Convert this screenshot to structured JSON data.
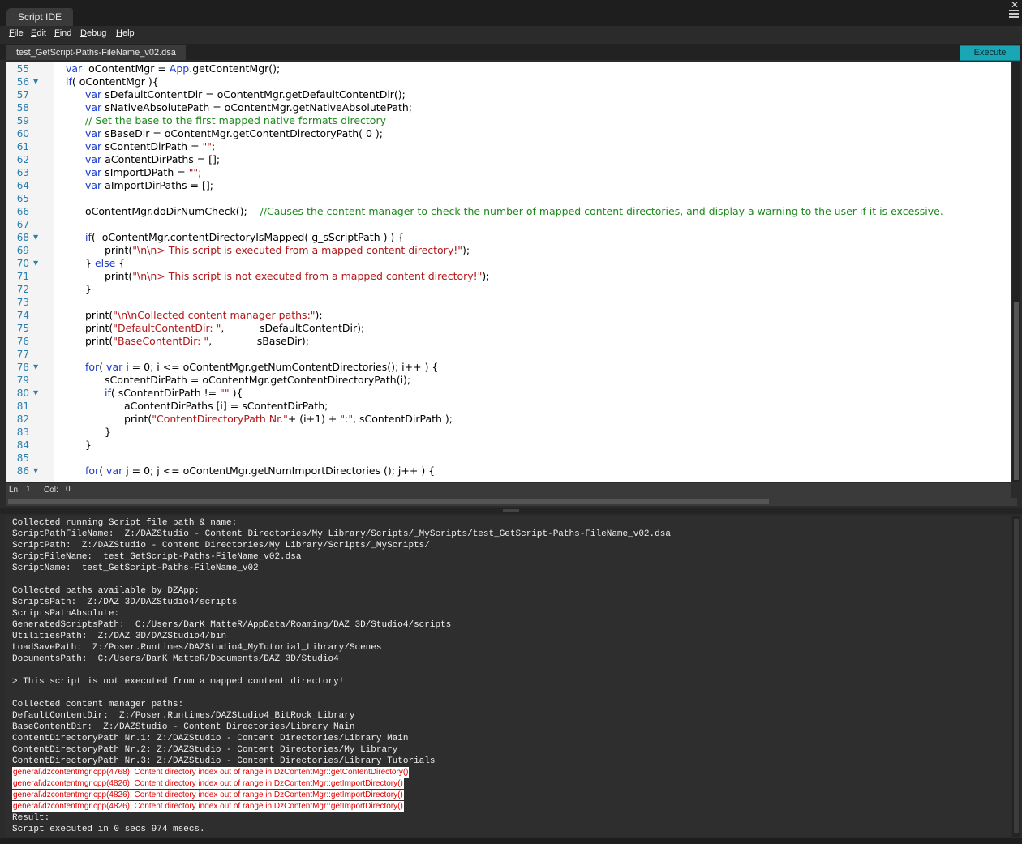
{
  "window": {
    "title": "Script IDE"
  },
  "menu": [
    {
      "accel": "F",
      "rest": "ile"
    },
    {
      "accel": "E",
      "rest": "dit"
    },
    {
      "accel": "F",
      "rest": "ind"
    },
    {
      "accel": "D",
      "rest": "ebug"
    },
    {
      "accel": "H",
      "rest": "elp"
    }
  ],
  "file_tab": "test_GetScript-Paths-FileName_v02.dsa",
  "execute_label": "Execute",
  "status": {
    "ln_label": "Ln:",
    "ln": "1",
    "col_label": "Col:",
    "col": "0"
  },
  "code_lines": [
    {
      "n": "55",
      "fold": false,
      "indent": 1,
      "parts": [
        [
          "kw",
          "var"
        ],
        [
          "",
          "  oContentMgr = "
        ],
        [
          "kw",
          "App"
        ],
        [
          "",
          ".getContentMgr();"
        ]
      ]
    },
    {
      "n": "56",
      "fold": true,
      "indent": 1,
      "parts": [
        [
          "kw",
          "if"
        ],
        [
          "",
          "( oContentMgr ){"
        ]
      ]
    },
    {
      "n": "57",
      "fold": false,
      "indent": 2,
      "parts": [
        [
          "kw",
          "var"
        ],
        [
          "",
          " sDefaultContentDir = oContentMgr.getDefaultContentDir();"
        ]
      ]
    },
    {
      "n": "58",
      "fold": false,
      "indent": 2,
      "parts": [
        [
          "kw",
          "var"
        ],
        [
          "",
          " sNativeAbsolutePath = oContentMgr.getNativeAbsolutePath;"
        ]
      ]
    },
    {
      "n": "59",
      "fold": false,
      "indent": 2,
      "parts": [
        [
          "cm",
          "// Set the base to the first mapped native formats directory"
        ]
      ]
    },
    {
      "n": "60",
      "fold": false,
      "indent": 2,
      "parts": [
        [
          "kw",
          "var"
        ],
        [
          "",
          " sBaseDir = oContentMgr.getContentDirectoryPath( 0 );"
        ]
      ]
    },
    {
      "n": "61",
      "fold": false,
      "indent": 2,
      "parts": [
        [
          "kw",
          "var"
        ],
        [
          "",
          " sContentDirPath = "
        ],
        [
          "st",
          "\"\""
        ],
        [
          "",
          ";"
        ]
      ]
    },
    {
      "n": "62",
      "fold": false,
      "indent": 2,
      "parts": [
        [
          "kw",
          "var"
        ],
        [
          "",
          " aContentDirPaths = [];"
        ]
      ]
    },
    {
      "n": "63",
      "fold": false,
      "indent": 2,
      "parts": [
        [
          "kw",
          "var"
        ],
        [
          "",
          " sImportDPath = "
        ],
        [
          "st",
          "\"\""
        ],
        [
          "",
          ";"
        ]
      ]
    },
    {
      "n": "64",
      "fold": false,
      "indent": 2,
      "parts": [
        [
          "kw",
          "var"
        ],
        [
          "",
          " aImportDirPaths = [];"
        ]
      ]
    },
    {
      "n": "65",
      "fold": false,
      "indent": 0,
      "parts": []
    },
    {
      "n": "66",
      "fold": false,
      "indent": 2,
      "parts": [
        [
          "",
          "oContentMgr.doDirNumCheck();    "
        ],
        [
          "cm",
          "//Causes the content manager to check the number of mapped content directories, and display a warning to the user if it is excessive."
        ]
      ]
    },
    {
      "n": "67",
      "fold": false,
      "indent": 0,
      "parts": []
    },
    {
      "n": "68",
      "fold": true,
      "indent": 2,
      "parts": [
        [
          "kw",
          "if"
        ],
        [
          "",
          "(  oContentMgr.contentDirectoryIsMapped( g_sScriptPath ) ) {"
        ]
      ]
    },
    {
      "n": "69",
      "fold": false,
      "indent": 3,
      "parts": [
        [
          "",
          "print("
        ],
        [
          "st",
          "\"\\n\\n> This script is executed from a mapped content directory!\""
        ],
        [
          "",
          ");"
        ]
      ]
    },
    {
      "n": "70",
      "fold": true,
      "indent": 2,
      "parts": [
        [
          "",
          "} "
        ],
        [
          "kw",
          "else"
        ],
        [
          "",
          " {"
        ]
      ]
    },
    {
      "n": "71",
      "fold": false,
      "indent": 3,
      "parts": [
        [
          "",
          "print("
        ],
        [
          "st",
          "\"\\n\\n> This script is not executed from a mapped content directory!\""
        ],
        [
          "",
          ");"
        ]
      ]
    },
    {
      "n": "72",
      "fold": false,
      "indent": 2,
      "parts": [
        [
          "",
          "}"
        ]
      ]
    },
    {
      "n": "73",
      "fold": false,
      "indent": 0,
      "parts": []
    },
    {
      "n": "74",
      "fold": false,
      "indent": 2,
      "parts": [
        [
          "",
          "print("
        ],
        [
          "st",
          "\"\\n\\nCollected content manager paths:\""
        ],
        [
          "",
          ");"
        ]
      ]
    },
    {
      "n": "75",
      "fold": false,
      "indent": 2,
      "parts": [
        [
          "",
          "print("
        ],
        [
          "st",
          "\"DefaultContentDir: \""
        ],
        [
          "",
          ",           sDefaultContentDir);"
        ]
      ]
    },
    {
      "n": "76",
      "fold": false,
      "indent": 2,
      "parts": [
        [
          "",
          "print("
        ],
        [
          "st",
          "\"BaseContentDir: \""
        ],
        [
          "",
          ",              sBaseDir);"
        ]
      ]
    },
    {
      "n": "77",
      "fold": false,
      "indent": 0,
      "parts": []
    },
    {
      "n": "78",
      "fold": true,
      "indent": 2,
      "parts": [
        [
          "kw",
          "for"
        ],
        [
          "",
          "( "
        ],
        [
          "kw",
          "var"
        ],
        [
          "",
          " i = 0; i <= oContentMgr.getNumContentDirectories(); i++ ) {"
        ]
      ]
    },
    {
      "n": "79",
      "fold": false,
      "indent": 3,
      "parts": [
        [
          "",
          "sContentDirPath = oContentMgr.getContentDirectoryPath(i);"
        ]
      ]
    },
    {
      "n": "80",
      "fold": true,
      "indent": 3,
      "parts": [
        [
          "kw",
          "if"
        ],
        [
          "",
          "( sContentDirPath != "
        ],
        [
          "st",
          "\"\""
        ],
        [
          "",
          " ){"
        ]
      ]
    },
    {
      "n": "81",
      "fold": false,
      "indent": 4,
      "parts": [
        [
          "",
          "aContentDirPaths [i] = sContentDirPath;"
        ]
      ]
    },
    {
      "n": "82",
      "fold": false,
      "indent": 4,
      "parts": [
        [
          "",
          "print("
        ],
        [
          "st",
          "\"ContentDirectoryPath Nr.\""
        ],
        [
          "",
          "+ (i+1) + "
        ],
        [
          "st",
          "\":\""
        ],
        [
          "",
          ", sContentDirPath );"
        ]
      ]
    },
    {
      "n": "83",
      "fold": false,
      "indent": 3,
      "parts": [
        [
          "",
          "}"
        ]
      ]
    },
    {
      "n": "84",
      "fold": false,
      "indent": 2,
      "parts": [
        [
          "",
          "}"
        ]
      ]
    },
    {
      "n": "85",
      "fold": false,
      "indent": 0,
      "parts": []
    },
    {
      "n": "86",
      "fold": true,
      "indent": 2,
      "parts": [
        [
          "kw",
          "for"
        ],
        [
          "",
          "( "
        ],
        [
          "kw",
          "var"
        ],
        [
          "",
          " j = 0; j <= oContentMgr.getNumImportDirectories (); j++ ) {"
        ]
      ]
    }
  ],
  "output_lines": [
    {
      "t": "n",
      "s": "Collected running Script file path & name:"
    },
    {
      "t": "n",
      "s": "ScriptPathFileName:  Z:/DAZStudio - Content Directories/My Library/Scripts/_MyScripts/test_GetScript-Paths-FileName_v02.dsa"
    },
    {
      "t": "n",
      "s": "ScriptPath:  Z:/DAZStudio - Content Directories/My Library/Scripts/_MyScripts/"
    },
    {
      "t": "n",
      "s": "ScriptFileName:  test_GetScript-Paths-FileName_v02.dsa"
    },
    {
      "t": "n",
      "s": "ScriptName:  test_GetScript-Paths-FileName_v02"
    },
    {
      "t": "n",
      "s": ""
    },
    {
      "t": "n",
      "s": "Collected paths available by DZApp:"
    },
    {
      "t": "n",
      "s": "ScriptsPath:  Z:/DAZ 3D/DAZStudio4/scripts"
    },
    {
      "t": "n",
      "s": "ScriptsPathAbsolute:"
    },
    {
      "t": "n",
      "s": "GeneratedScriptsPath:  C:/Users/DarK MatteR/AppData/Roaming/DAZ 3D/Studio4/scripts"
    },
    {
      "t": "n",
      "s": "UtilitiesPath:  Z:/DAZ 3D/DAZStudio4/bin"
    },
    {
      "t": "n",
      "s": "LoadSavePath:  Z:/Poser.Runtimes/DAZStudio4_MyTutorial_Library/Scenes"
    },
    {
      "t": "n",
      "s": "DocumentsPath:  C:/Users/DarK MatteR/Documents/DAZ 3D/Studio4"
    },
    {
      "t": "n",
      "s": ""
    },
    {
      "t": "n",
      "s": "> This script is not executed from a mapped content directory!"
    },
    {
      "t": "n",
      "s": ""
    },
    {
      "t": "n",
      "s": "Collected content manager paths:"
    },
    {
      "t": "n",
      "s": "DefaultContentDir:  Z:/Poser.Runtimes/DAZStudio4_BitRock_Library"
    },
    {
      "t": "n",
      "s": "BaseContentDir:  Z:/DAZStudio - Content Directories/Library Main"
    },
    {
      "t": "n",
      "s": "ContentDirectoryPath Nr.1: Z:/DAZStudio - Content Directories/Library Main"
    },
    {
      "t": "n",
      "s": "ContentDirectoryPath Nr.2: Z:/DAZStudio - Content Directories/My Library"
    },
    {
      "t": "n",
      "s": "ContentDirectoryPath Nr.3: Z:/DAZStudio - Content Directories/Library Tutorials"
    },
    {
      "t": "e",
      "s": "general\\dzcontentmgr.cpp(4768): Content directory index out of range in DzContentMgr::getContentDirectory()"
    },
    {
      "t": "e",
      "s": "general\\dzcontentmgr.cpp(4826): Content directory index out of range in DzContentMgr::getImportDirectory()"
    },
    {
      "t": "e",
      "s": "general\\dzcontentmgr.cpp(4826): Content directory index out of range in DzContentMgr::getImportDirectory()"
    },
    {
      "t": "e",
      "s": "general\\dzcontentmgr.cpp(4826): Content directory index out of range in DzContentMgr::getImportDirectory()"
    },
    {
      "t": "n",
      "s": "Result:"
    },
    {
      "t": "n",
      "s": "Script executed in 0 secs 974 msecs."
    }
  ]
}
